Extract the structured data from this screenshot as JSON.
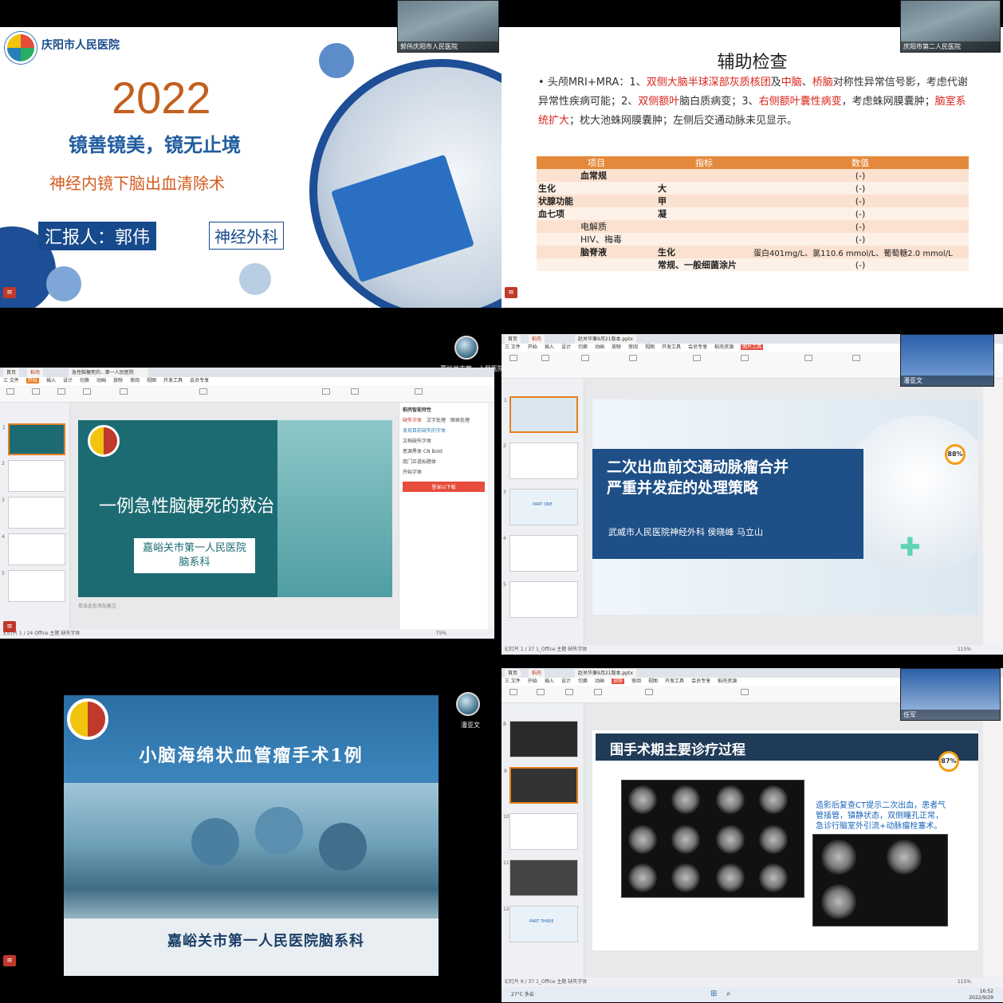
{
  "p1": {
    "hospital": "庆阳市人民医院",
    "year": "2022",
    "motto": "镜善镜美，镜无止境",
    "topic": "神经内镜下脑出血清除术",
    "reporter": "汇报人：郭伟",
    "department": "神经外科",
    "cam_label": "郭伟庆阳市人民医院"
  },
  "p2": {
    "title": "辅助检查",
    "para_lead": "头颅MRI+MRA：1、",
    "para_parts": [
      "双侧大脑半球深部灰质核团",
      "及",
      "中脑",
      "、",
      "桥脑",
      "对称性异常信号影，考虑代谢异常性疾病可能；2、",
      "双侧额叶",
      "脑白质病变；3、",
      "右侧额叶囊性病变",
      "，考虑蛛网膜囊肿；",
      "脑室系统扩大",
      "；枕大池蛛网膜囊肿；左侧后交通动脉未见显示。"
    ],
    "table_headers": [
      "项目",
      "指标",
      "数值"
    ],
    "rows": [
      [
        "血常规",
        "",
        "(-)"
      ],
      [
        "生化",
        "大",
        "(-)"
      ],
      [
        "状腺功能",
        "甲",
        "(-)"
      ],
      [
        "血七项",
        "凝",
        "(-)"
      ],
      [
        "电解质",
        "",
        "(-)"
      ],
      [
        "HIV、梅毒",
        "",
        "(-)"
      ],
      [
        "脑脊液",
        "生化",
        "蛋白401mg/L、氯110.6  mmol/L、葡萄糖2.0 mmol/L"
      ],
      [
        "",
        "常规、一般细菌涂片",
        "(-)"
      ]
    ],
    "cam_label": "庆阳市第二人民医院"
  },
  "p3": {
    "tabs": [
      "首页",
      "稻壳",
      "急性脑梗死的...第一人民医院"
    ],
    "menu": [
      "三 文件",
      "开始",
      "插入",
      "设计",
      "切换",
      "动画",
      "放映",
      "审阅",
      "视图",
      "开发工具",
      "会员专享"
    ],
    "slide_title": "一例急性脑梗死的救治",
    "org_line1": "嘉峪关市第一人民医院",
    "org_line2": "脑系科",
    "panel_title": "稻壳智能特性",
    "panel_tabs": [
      "缺失字体",
      "文字处理",
      "图表处理"
    ],
    "panel_items": [
      "发现目前缺失的字体",
      "文档缺失字体",
      "思源黑体 CN Bold",
      "庞门正道标题体",
      "开始字体"
    ],
    "panel_button": "登录以下载",
    "status": "幻灯片 1 / 24    Office 主题    缺失字体",
    "note": "单击此处添加备注",
    "zoom": "75%",
    "cam_label": "嘉峪关市第一人民医院"
  },
  "p4": {
    "tabs": [
      "首页",
      "稻壳",
      "赵关华兼9月21版本.pptx"
    ],
    "menu": [
      "三 文件",
      "开始",
      "插入",
      "设计",
      "切换",
      "动画",
      "放映",
      "审阅",
      "视图",
      "开发工具",
      "会员专享",
      "稻壳资源",
      "图片工具"
    ],
    "slide_title1": "二次出血前交通动脉瘤合并",
    "slide_title2": "严重并发症的处理策略",
    "org": "武威市人民医院神经外科      侯晓峰  马立山",
    "status": "幻灯片 1 / 37    1_Office 主题    缺失字体",
    "zoom": "115%",
    "gauge": "88%",
    "cam_label": "潘亚文",
    "thumb_part": "PART ONE"
  },
  "p5": {
    "title": "小脑海绵状血管瘤手术1例",
    "org": "嘉峪关市第一人民医院脑系科",
    "cam_label": "潘亚文"
  },
  "p6": {
    "tabs": [
      "首页",
      "稻壳",
      "赵关华兼9月21版本.pptx"
    ],
    "menu": [
      "三 文件",
      "开始",
      "插入",
      "设计",
      "切换",
      "动画",
      "放映",
      "审阅",
      "视图",
      "开发工具",
      "会员专享",
      "稻壳资源"
    ],
    "slide_title": "围手术期主要诊疗过程",
    "text": "造影后复查CT提示二次出血，患者气管插管，镇静状态，双侧瞳孔正常，急诊行脑室外引流+动脉瘤栓塞术。",
    "status": "幻灯片 9 / 37    1_Office 主题    缺失字体",
    "zoom": "115%",
    "gauge": "87%",
    "temp": "27°C",
    "weather": "多云",
    "time": "16:52",
    "date": "2022/9/29",
    "cam_label": "任军",
    "thumb_part": "PART THREE"
  },
  "colors": {
    "accent_orange": "#e4893b",
    "navy": "#1e4f86",
    "teal": "#1c6b73",
    "red": "#d9241c"
  }
}
